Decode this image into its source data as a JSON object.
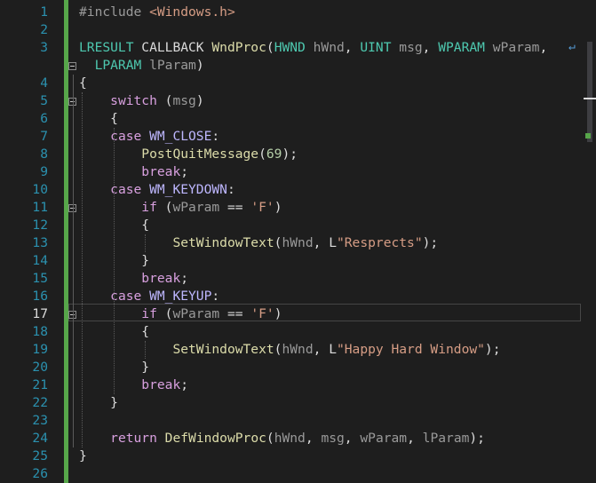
{
  "editor": {
    "current_line": "17",
    "line_numbers": [
      "1",
      "2",
      "3",
      "",
      "4",
      "5",
      "6",
      "7",
      "8",
      "9",
      "10",
      "11",
      "12",
      "13",
      "14",
      "15",
      "16",
      "17",
      "18",
      "19",
      "20",
      "21",
      "22",
      "23",
      "24",
      "25",
      "26"
    ],
    "lines": [
      [
        {
          "c": "pp",
          "t": "#include "
        },
        {
          "c": "inc",
          "t": "<Windows.h>"
        }
      ],
      [],
      [
        {
          "c": "ty",
          "t": "LRESULT "
        },
        {
          "c": "txt",
          "t": "CALLBACK "
        },
        {
          "c": "fn",
          "t": "WndProc"
        },
        {
          "c": "txt",
          "t": "("
        },
        {
          "c": "ty",
          "t": "HWND "
        },
        {
          "c": "par",
          "t": "hWnd"
        },
        {
          "c": "txt",
          "t": ", "
        },
        {
          "c": "ty",
          "t": "UINT "
        },
        {
          "c": "par",
          "t": "msg"
        },
        {
          "c": "txt",
          "t": ", "
        },
        {
          "c": "ty",
          "t": "WPARAM "
        },
        {
          "c": "par",
          "t": "wParam"
        },
        {
          "c": "txt",
          "t": ","
        }
      ],
      [
        {
          "c": "txt",
          "t": "  "
        },
        {
          "c": "ty",
          "t": "LPARAM "
        },
        {
          "c": "par",
          "t": "lParam"
        },
        {
          "c": "txt",
          "t": ")"
        }
      ],
      [
        {
          "c": "txt",
          "t": "{"
        }
      ],
      [
        {
          "c": "txt",
          "t": "    "
        },
        {
          "c": "kw",
          "t": "switch"
        },
        {
          "c": "txt",
          "t": " ("
        },
        {
          "c": "par",
          "t": "msg"
        },
        {
          "c": "txt",
          "t": ")"
        }
      ],
      [
        {
          "c": "txt",
          "t": "    {"
        }
      ],
      [
        {
          "c": "txt",
          "t": "    "
        },
        {
          "c": "kw",
          "t": "case "
        },
        {
          "c": "mac",
          "t": "WM_CLOSE"
        },
        {
          "c": "txt",
          "t": ":"
        }
      ],
      [
        {
          "c": "txt",
          "t": "        "
        },
        {
          "c": "fn",
          "t": "PostQuitMessage"
        },
        {
          "c": "txt",
          "t": "("
        },
        {
          "c": "num",
          "t": "69"
        },
        {
          "c": "txt",
          "t": ");"
        }
      ],
      [
        {
          "c": "txt",
          "t": "        "
        },
        {
          "c": "kw",
          "t": "break"
        },
        {
          "c": "txt",
          "t": ";"
        }
      ],
      [
        {
          "c": "txt",
          "t": "    "
        },
        {
          "c": "kw",
          "t": "case "
        },
        {
          "c": "mac",
          "t": "WM_KEYDOWN"
        },
        {
          "c": "txt",
          "t": ":"
        }
      ],
      [
        {
          "c": "txt",
          "t": "        "
        },
        {
          "c": "kw",
          "t": "if"
        },
        {
          "c": "txt",
          "t": " ("
        },
        {
          "c": "par",
          "t": "wParam"
        },
        {
          "c": "txt",
          "t": " == "
        },
        {
          "c": "str",
          "t": "'F'"
        },
        {
          "c": "txt",
          "t": ")"
        }
      ],
      [
        {
          "c": "txt",
          "t": "        {"
        }
      ],
      [
        {
          "c": "txt",
          "t": "            "
        },
        {
          "c": "fn",
          "t": "SetWindowText"
        },
        {
          "c": "txt",
          "t": "("
        },
        {
          "c": "par",
          "t": "hWnd"
        },
        {
          "c": "txt",
          "t": ", L"
        },
        {
          "c": "str",
          "t": "\"Resprects\""
        },
        {
          "c": "txt",
          "t": ");"
        }
      ],
      [
        {
          "c": "txt",
          "t": "        }"
        }
      ],
      [
        {
          "c": "txt",
          "t": "        "
        },
        {
          "c": "kw",
          "t": "break"
        },
        {
          "c": "txt",
          "t": ";"
        }
      ],
      [
        {
          "c": "txt",
          "t": "    "
        },
        {
          "c": "kw",
          "t": "case "
        },
        {
          "c": "mac",
          "t": "WM_KEYUP"
        },
        {
          "c": "txt",
          "t": ":"
        }
      ],
      [
        {
          "c": "txt",
          "t": "        "
        },
        {
          "c": "kw",
          "t": "if"
        },
        {
          "c": "txt",
          "t": " ("
        },
        {
          "c": "par",
          "t": "wParam"
        },
        {
          "c": "txt",
          "t": " == "
        },
        {
          "c": "str",
          "t": "'F'"
        },
        {
          "c": "txt",
          "t": ")"
        }
      ],
      [
        {
          "c": "txt",
          "t": "        {"
        }
      ],
      [
        {
          "c": "txt",
          "t": "            "
        },
        {
          "c": "fn",
          "t": "SetWindowText"
        },
        {
          "c": "txt",
          "t": "("
        },
        {
          "c": "par",
          "t": "hWnd"
        },
        {
          "c": "txt",
          "t": ", L"
        },
        {
          "c": "str",
          "t": "\"Happy Hard Window\""
        },
        {
          "c": "txt",
          "t": ");"
        }
      ],
      [
        {
          "c": "txt",
          "t": "        }"
        }
      ],
      [
        {
          "c": "txt",
          "t": "        "
        },
        {
          "c": "kw",
          "t": "break"
        },
        {
          "c": "txt",
          "t": ";"
        }
      ],
      [
        {
          "c": "txt",
          "t": "    }"
        }
      ],
      [],
      [
        {
          "c": "txt",
          "t": "    "
        },
        {
          "c": "kw",
          "t": "return "
        },
        {
          "c": "fn",
          "t": "DefWindowProc"
        },
        {
          "c": "txt",
          "t": "("
        },
        {
          "c": "par",
          "t": "hWnd"
        },
        {
          "c": "txt",
          "t": ", "
        },
        {
          "c": "par",
          "t": "msg"
        },
        {
          "c": "txt",
          "t": ", "
        },
        {
          "c": "par",
          "t": "wParam"
        },
        {
          "c": "txt",
          "t": ", "
        },
        {
          "c": "par",
          "t": "lParam"
        },
        {
          "c": "txt",
          "t": ");"
        }
      ],
      [
        {
          "c": "txt",
          "t": "}"
        }
      ],
      []
    ]
  },
  "colors": {
    "background": "#1e1e1e",
    "line_number": "#2b91af",
    "change_bar": "#57a64a"
  },
  "icons": {
    "wrap": "word-wrap-icon",
    "fold": "collapse-icon"
  }
}
